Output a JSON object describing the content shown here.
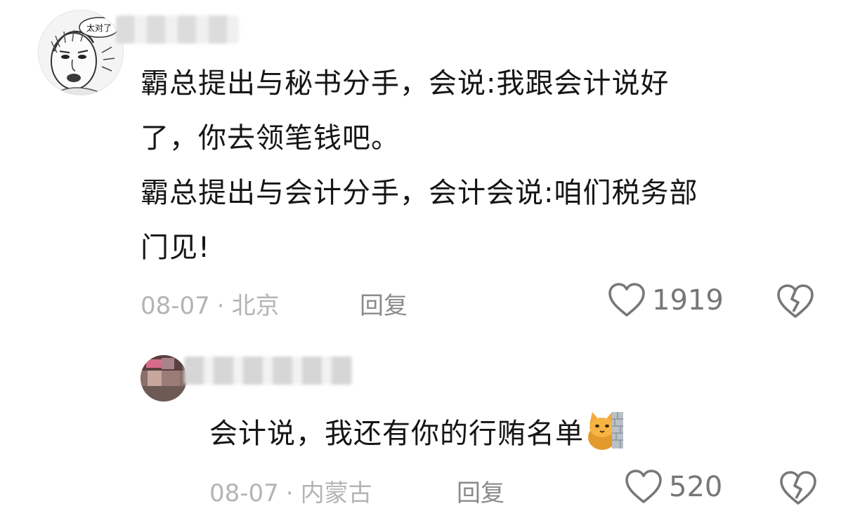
{
  "comments": [
    {
      "text_lines": [
        "霸总提出与秘书分手，会说:我跟会计说好",
        "了，你去领笔钱吧。",
        "霸总提出与会计分手，会计会说:咱们税务部",
        "门见!"
      ],
      "avatar_caption": "太对了",
      "date": "08-07",
      "location": "北京",
      "reply_label": "回复",
      "likes": "1919"
    },
    {
      "text": "会计说，我还有你的行贿名单",
      "emoji": "cat-peeking-behind-wall-icon",
      "date": "08-07",
      "location": "内蒙古",
      "reply_label": "回复",
      "likes": "520"
    }
  ],
  "colors": {
    "text": "#151515",
    "meta": "#b4b4b4",
    "reply": "#8a8a8a",
    "icon": "#777777",
    "background": "#ffffff"
  }
}
